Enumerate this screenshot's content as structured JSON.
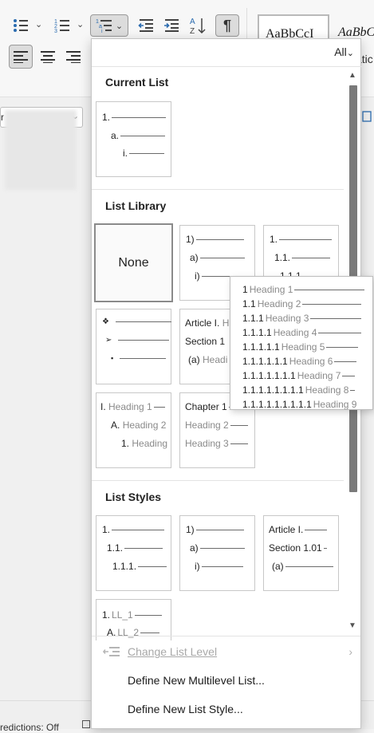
{
  "ribbon": {
    "style_preview_1": "AaBbCcI",
    "style_preview_2": "AaBbC",
    "style_sub": "atic",
    "font_box_partial": "r"
  },
  "status": {
    "predictions": "redictions: Off"
  },
  "panel": {
    "filter_label": "All",
    "sections": {
      "current_list": "Current List",
      "list_library": "List Library",
      "list_styles": "List Styles"
    },
    "current_list_tile": [
      "1.",
      "a.",
      "i."
    ],
    "library": {
      "none_label": "None",
      "tile_paren": [
        "1)",
        "a)",
        "i)"
      ],
      "tile_decimal": [
        "1.",
        "1.1.",
        "1.1.1."
      ],
      "tile_bullets": [
        "❖",
        "➢",
        "▪"
      ],
      "tile_article": [
        "Article I.",
        "H",
        "Section 1",
        "(a)",
        "Headi"
      ],
      "tile_roman_headings": [
        "I.",
        "Heading 1",
        "A.",
        "Heading 2",
        "1.",
        "Heading"
      ],
      "tile_chapter": [
        "Chapter 1",
        "Heading 2",
        "Heading 3"
      ]
    },
    "styles": {
      "tile_decimal": [
        "1.",
        "1.1.",
        "1.1.1."
      ],
      "tile_paren": [
        "1)",
        "a)",
        "i)"
      ],
      "tile_article": [
        "Article I.",
        "Section 1.01",
        "(a)"
      ],
      "tile_ll": [
        "1.",
        "LL_1",
        "A.",
        "LL_2"
      ]
    },
    "menu": {
      "change_level": "Change List Level",
      "define_multilevel": "Define New Multilevel List...",
      "define_style": "Define New List Style..."
    }
  },
  "heading_preview": [
    {
      "num": "1",
      "label": "Heading 1"
    },
    {
      "num": "1.1",
      "label": "Heading 2"
    },
    {
      "num": "1.1.1",
      "label": "Heading 3"
    },
    {
      "num": "1.1.1.1",
      "label": "Heading 4"
    },
    {
      "num": "1.1.1.1.1",
      "label": "Heading 5"
    },
    {
      "num": "1.1.1.1.1.1",
      "label": "Heading 6"
    },
    {
      "num": "1.1.1.1.1.1.1",
      "label": "Heading 7"
    },
    {
      "num": "1.1.1.1.1.1.1.1",
      "label": "Heading 8"
    },
    {
      "num": "1.1.1.1.1.1.1.1.1",
      "label": "Heading 9"
    }
  ],
  "icons": {
    "bullets": "bullets-icon",
    "numbering": "numbering-icon",
    "multilevel": "multilevel-list-icon",
    "outdent": "decrease-indent-icon",
    "indent": "increase-indent-icon",
    "sort": "sort-icon",
    "pilcrow": "show-formatting-icon"
  },
  "colors": {
    "accent": "#2b6cb0",
    "thumb": "#7a7a7a"
  }
}
